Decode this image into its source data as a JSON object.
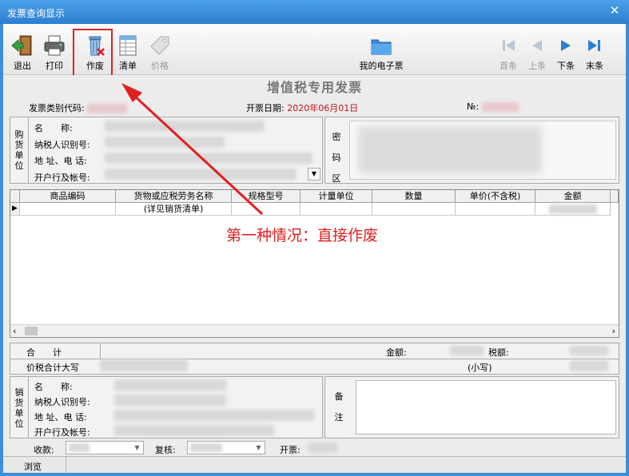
{
  "window": {
    "title": "发票查询显示",
    "close_glyph": "✕"
  },
  "toolbar": {
    "exit": "退出",
    "print": "打印",
    "void": "作废",
    "list": "清单",
    "price": "价格",
    "my_einvoice": "我的电子票",
    "first": "首条",
    "prev": "上条",
    "next": "下条",
    "last": "末条"
  },
  "invoice": {
    "title": "增值税专用发票",
    "category_code_label": "发票类别代码:",
    "date_label": "开票日期:",
    "date_value": "2020年06月01日",
    "number_label": "№:"
  },
  "buyer": {
    "side_label": "购货单位",
    "name_label": "名　　称:",
    "tax_id_label": "纳税人识别号:",
    "address_label": "地 址、电 话:",
    "bank_label": "开户行及帐号:",
    "cipher_label": "密码区"
  },
  "grid": {
    "columns": [
      "商品编码",
      "货物或应税劳务名称",
      "规格型号",
      "计量单位",
      "数量",
      "单价(不含税)",
      "金额"
    ],
    "rows": [
      {
        "name": "(详见销货清单)"
      }
    ]
  },
  "summary": {
    "total_label": "合　　计",
    "amount_label": "金额:",
    "tax_label": "税额:",
    "total_caps_label": "价税合计大写",
    "small_label": "(小写)"
  },
  "seller": {
    "side_label": "销货单位",
    "name_label": "名　　称:",
    "tax_id_label": "纳税人识别号:",
    "address_label": "地 址、电 话:",
    "bank_label": "开户行及帐号:",
    "remark_label": "备注"
  },
  "footer": {
    "payee_label": "收款:",
    "reviewer_label": "复核:",
    "issuer_label": "开票:"
  },
  "status": {
    "mode": "浏览"
  },
  "annotation": {
    "text": "第一种情况：直接作废"
  },
  "colors": {
    "accent": "#2d7fcf",
    "annotation": "#e02020",
    "date": "#c01818"
  }
}
